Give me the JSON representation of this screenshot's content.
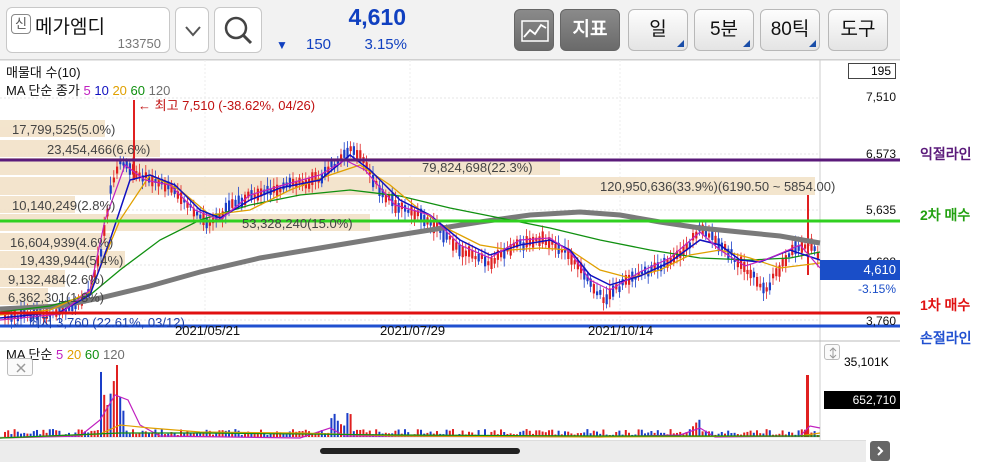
{
  "header": {
    "badge": "신",
    "stock_name": "메가엠디",
    "stock_code": "133750",
    "price": "4,610",
    "change_arrow": "▼",
    "change_value": "150",
    "change_pct": "3.15%"
  },
  "toolbar": {
    "indicator_label": "지표",
    "period_label": "일",
    "interval_label": "5분",
    "tick_label": "80틱",
    "tools_label": "도구"
  },
  "main_chart": {
    "volume_profile_label": "매물대 수(10)",
    "ma_label": "MA 단순 종가",
    "ma_periods": [
      "5",
      "10",
      "20",
      "60",
      "120"
    ],
    "ma_colors": [
      "#c020c0",
      "#1010c0",
      "#e0a000",
      "#109010",
      "#707070"
    ],
    "high_annotation": "← 최고 7,510 (-38.62%, 04/26)",
    "low_annotation": "← 최저 3,760 (22.61%, 03/12)",
    "volume_profile_values": [
      "17,799,525(5.0%)",
      "23,454,466(6.6%)",
      "79,824,698(22.3%)",
      "120,950,636(33.9%)(6190.50 ~ 5854.00)",
      "10,140,249(2.8%)",
      "53,328,240(15.0%)",
      "16,604,939(4.6%)",
      "19,439,944(5.4%)",
      "9,132,484(2.6%)",
      "6,362,301(1.8%)"
    ],
    "dates": [
      "2021/05/21",
      "2021/07/29",
      "2021/10/14"
    ],
    "price_axis": [
      "7,510",
      "6,573",
      "5,635",
      "4,698",
      "3,760"
    ],
    "axis_top_value": "195",
    "current_price_tag": "4,610",
    "current_pct": "-3.15%",
    "lines": {
      "take_profit": "익절라인",
      "second_buy": "2차 매수",
      "first_buy": "1차 매수",
      "stop_loss": "손절라인"
    },
    "line_colors": {
      "take_profit": "#5a1a7a",
      "second_buy": "#30d020",
      "first_buy": "#e01010",
      "stop_loss": "#2050d0"
    }
  },
  "volume_chart": {
    "ma_label": "MA 단순",
    "ma_periods": [
      "5",
      "20",
      "60",
      "120"
    ],
    "ma_colors": [
      "#c020c0",
      "#e0a000",
      "#109010",
      "#707070"
    ],
    "axis_top": "35,101K",
    "current_volume": "652,710"
  }
}
